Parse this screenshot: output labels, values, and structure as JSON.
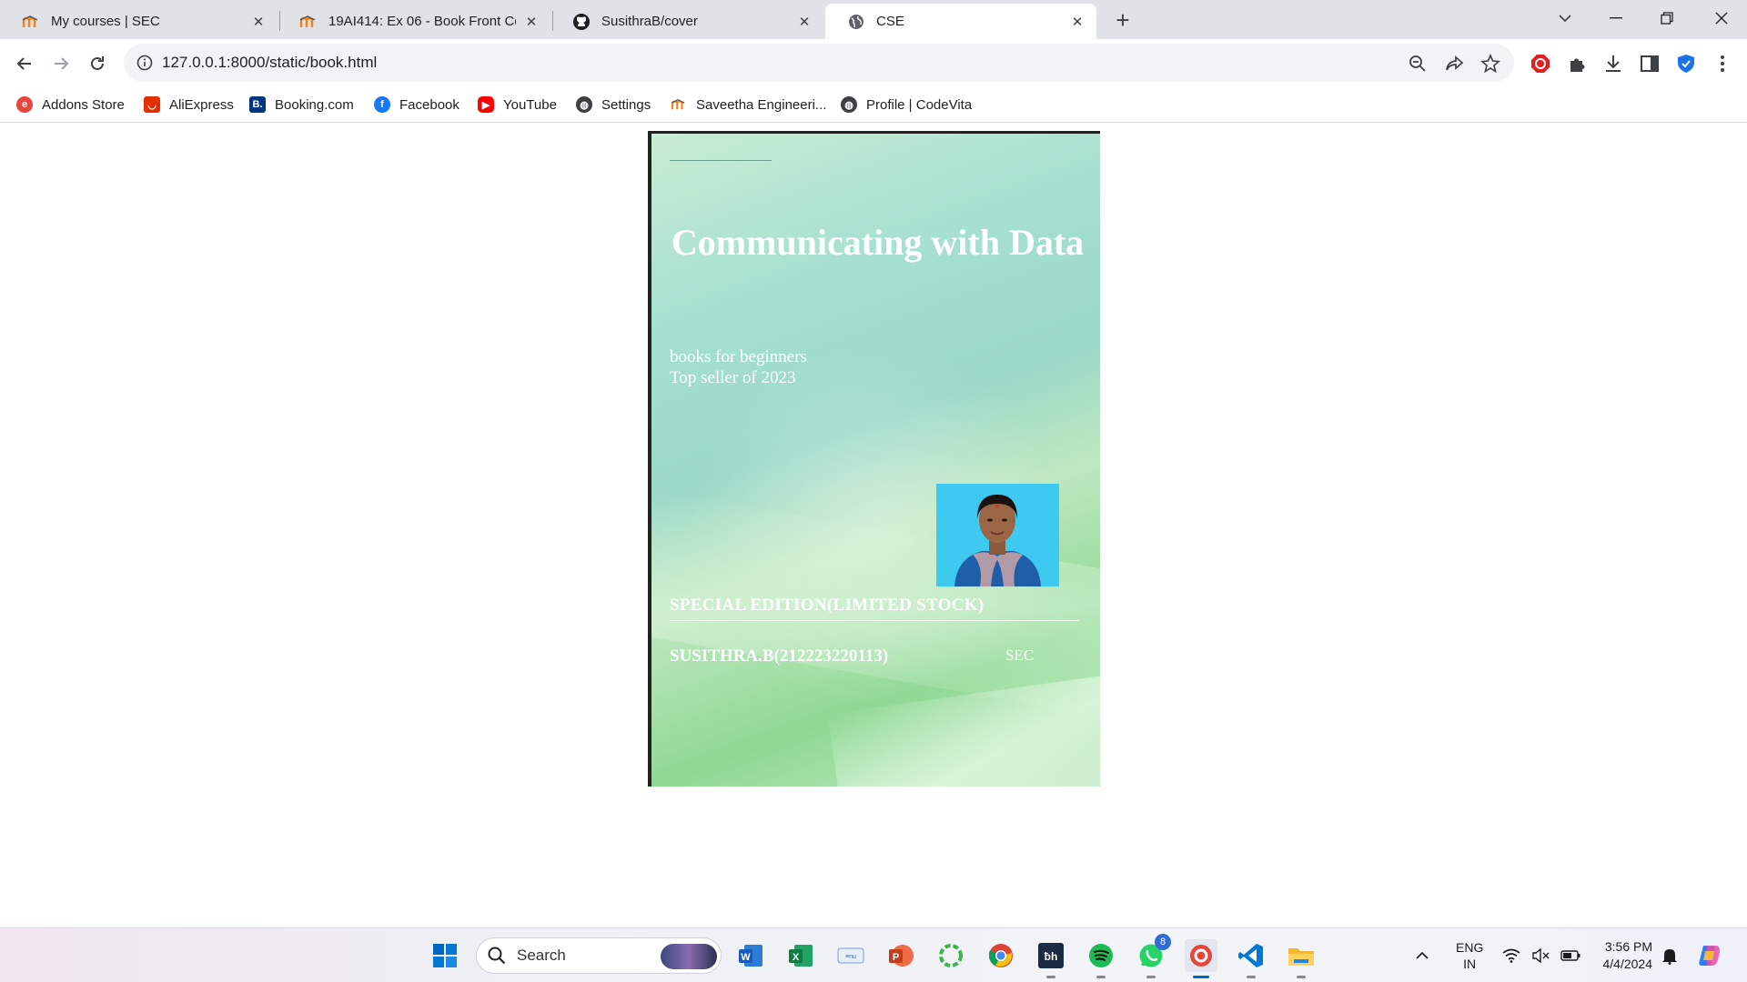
{
  "browser": {
    "tabs": [
      {
        "title": "My courses | SEC",
        "icon": "moodle-icon",
        "active": false
      },
      {
        "title": "19AI414: Ex 06 - Book Front Cov",
        "icon": "moodle-icon",
        "active": false
      },
      {
        "title": "SusithraB/cover",
        "icon": "github-icon",
        "active": false
      },
      {
        "title": "CSE",
        "icon": "globe-icon",
        "active": true
      }
    ],
    "new_tab_label": "+",
    "url": "127.0.0.1:8000/static/book.html",
    "bookmarks": [
      {
        "label": "Addons Store",
        "icon": "addons-icon",
        "color": "#e8453c"
      },
      {
        "label": "AliExpress",
        "icon": "aliexpress-icon",
        "color": "#e62e04"
      },
      {
        "label": "Booking.com",
        "icon": "booking-icon",
        "color": "#003580"
      },
      {
        "label": "Facebook",
        "icon": "facebook-icon",
        "color": "#1877f2"
      },
      {
        "label": "YouTube",
        "icon": "youtube-icon",
        "color": "#ff0000"
      },
      {
        "label": "Settings",
        "icon": "globe-icon",
        "color": "#3c4043"
      },
      {
        "label": "Saveetha Engineeri...",
        "icon": "moodle-icon",
        "color": "#f98012"
      },
      {
        "label": "Profile | CodeVita",
        "icon": "globe-icon",
        "color": "#3c4043"
      }
    ]
  },
  "cover": {
    "title": "Communicating with Data",
    "subtitle_line1": "books for beginners",
    "subtitle_line2": "Top seller of 2023",
    "edition": "SPECIAL EDITION(LIMITED STOCK)",
    "author": "SUSITHRA.B(212223220113)",
    "college": "SEC",
    "photo": "author-portrait"
  },
  "taskbar": {
    "search_placeholder": "Search",
    "whatsapp_badge": "8",
    "language_line1": "ENG",
    "language_line2": "IN",
    "time": "3:56 PM",
    "date": "4/4/2024"
  },
  "colors": {
    "tab_strip": "#dfe3e8",
    "cover_green": "#9ad8c8",
    "taskbar_accent": "#0067c0"
  }
}
